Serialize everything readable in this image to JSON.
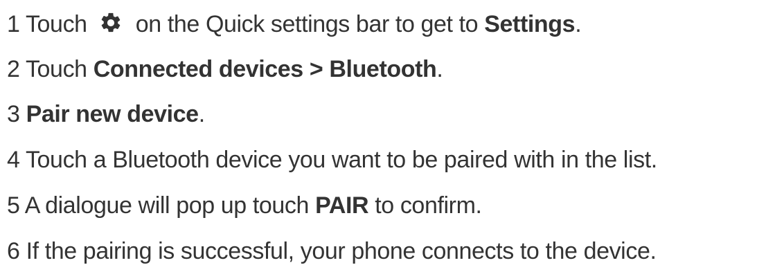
{
  "steps": [
    {
      "number": "1",
      "text_before_icon": "Touch",
      "icon": "gear-icon",
      "text_after_icon": "on the Quick settings bar to get to",
      "bold": "Settings",
      "end": "."
    },
    {
      "number": "2",
      "text": "Touch",
      "bold": "Connected devices > Bluetooth",
      "end": "."
    },
    {
      "number": "3",
      "bold": "Pair new device",
      "end": "."
    },
    {
      "number": "4",
      "text": "Touch a Bluetooth device you want to be paired with in the list."
    },
    {
      "number": "5",
      "text": "A dialogue will pop up touch",
      "bold": "PAIR",
      "end": "to confirm."
    },
    {
      "number": "6",
      "text": "If the pairing is successful, your phone connects to the device."
    }
  ],
  "colors": {
    "text": "#333333",
    "icon": "#333333"
  }
}
